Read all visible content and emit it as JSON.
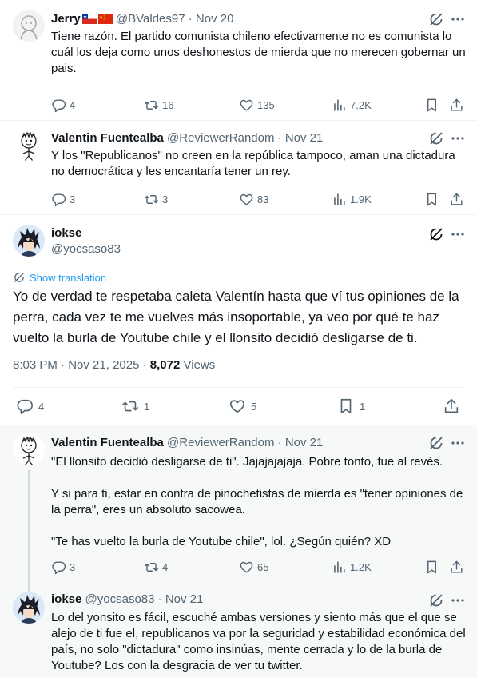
{
  "tweets": {
    "t1": {
      "name": "Jerry",
      "handle": "@BValdes97",
      "sep": "·",
      "date": "Nov 20",
      "text": "Tiene razón. El partido comunista chileno efectivamente no es comunista lo cuál los deja como unos deshonestos de mierda que no merecen gobernar un pais.",
      "replies": "4",
      "retweets": "16",
      "likes": "135",
      "views": "7.2K"
    },
    "t2": {
      "name": "Valentin Fuentealba",
      "handle": "@ReviewerRandom",
      "sep": "·",
      "date": "Nov 21",
      "text": "Y los \"Republicanos\" no creen en la república tampoco, aman una dictadura no democrática y les encantaría tener un rey.",
      "replies": "3",
      "retweets": "3",
      "likes": "83",
      "views": "1.9K"
    },
    "main": {
      "name": "iokse",
      "handle": "@yocsaso83",
      "show_translation": "Show translation",
      "text": "Yo de verdad te respetaba caleta Valentín hasta que ví tus opiniones de la perra, cada vez te me vuelves más insoportable, ya veo por qué te haz vuelto la burla de Youtube chile y el llonsito decidió desligarse de ti.",
      "time": "8:03 PM",
      "sep": "·",
      "date": "Nov 21, 2025",
      "views_count": "8,072",
      "views_label": "Views",
      "replies": "4",
      "retweets": "1",
      "likes": "5",
      "bookmarks": "1"
    },
    "t3": {
      "name": "Valentin Fuentealba",
      "handle": "@ReviewerRandom",
      "sep": "·",
      "date": "Nov 21",
      "text": "\"El llonsito decidió desligarse de ti\". Jajajajajaja. Pobre tonto, fue al revés.\n\nY si para ti, estar en contra de pinochetistas de mierda es \"tener opiniones de la perra\", eres un absoluto sacowea.\n\n\"Te has vuelto la burla de Youtube chile\", lol. ¿Según quién? XD",
      "replies": "3",
      "retweets": "4",
      "likes": "65",
      "views": "1.2K"
    },
    "t4": {
      "name": "iokse",
      "handle": "@yocsaso83",
      "sep": "·",
      "date": "Nov 21",
      "text": "Lo del yonsito es fácil, escuché ambas versiones y siento más que el que se alejo de ti fue el, republicanos va por la seguridad y estabilidad económica del país, no solo \"dictadura\" como insinúas, mente cerrada y lo de la burla de Youtube? Los con la desgracia de ver tu twitter."
    }
  },
  "icons": {
    "reply": "reply-icon",
    "retweet": "retweet-icon",
    "like": "heart-icon",
    "views": "views-icon",
    "bookmark": "bookmark-icon",
    "share": "share-icon",
    "grok": "grok-icon",
    "more": "more-icon",
    "translate": "translate-icon"
  },
  "colors": {
    "accent": "#1d9bf0",
    "muted": "#536471",
    "text": "#0f1419",
    "highlight_bg": "#f7f9f9",
    "line": "#cfd9de"
  }
}
